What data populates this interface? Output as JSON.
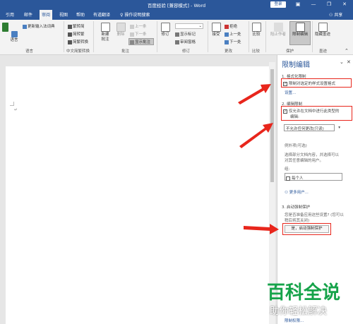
{
  "titlebar": {
    "title": "百度经验 [兼容模式] - Word",
    "login_label": "登录",
    "minimize_icon": "minimize-icon",
    "restore_icon": "restore-icon",
    "close_icon": "close-icon"
  },
  "tabs": [
    "引用",
    "邮件",
    "审阅",
    "视图",
    "帮助",
    "有道翻译"
  ],
  "active_tab": "审阅",
  "tell_me": "操作说明搜索",
  "share_label": "共享",
  "ribbon": {
    "language_group": {
      "item1": "更新输入法词典",
      "item2": "语言",
      "label": "语言"
    },
    "chinese_group": {
      "trad_to_simp": "繁转简",
      "simp_to_trad": "简转繁",
      "convert": "简繁转换",
      "label": "中文简繁转换"
    },
    "comments_group": {
      "new_comment": "新建批注",
      "new_comment_l1": "新建",
      "new_comment_l2": "批注",
      "delete": "删除",
      "previous": "上一条",
      "next": "下一条",
      "show_comments": "显示批注",
      "label": "批注"
    },
    "tracking_group": {
      "track_changes": "修订",
      "show_markup": "显示标记",
      "reviewing_pane": "审阅窗格",
      "label": "修订"
    },
    "changes_group": {
      "accept": "接受",
      "reject": "拒绝",
      "previous": "上一处",
      "next": "下一处",
      "label": "更改"
    },
    "compare_group": {
      "compare": "比较",
      "label": "比较"
    },
    "protect_group": {
      "block_authors": "阻止作者",
      "restrict_editing": "限制编辑",
      "label": "保护"
    },
    "ink_group": {
      "hide_ink": "隐藏墨迹",
      "label": "墨迹"
    }
  },
  "pane": {
    "title": "限制编辑",
    "section1": "1. 格式化限制",
    "formatting_checkbox": "限制对选定的样式设置格式",
    "formatting_checked": true,
    "settings_link": "设置...",
    "section2": "2. 编辑限制",
    "editing_checkbox_line1": "仅允许在文档中进行此类型的",
    "editing_checkbox_line2": "编辑:",
    "editing_checked": true,
    "editing_dropdown": "不允许任何更改(只读)",
    "exceptions_title": "例外项(可选)",
    "exceptions_desc1": "选择部分文档内容，并选择可以",
    "exceptions_desc2": "对其任意编辑的用户。",
    "groups_label": "组:",
    "everyone": "每个人",
    "more_users": "更多用户...",
    "section3": "3. 启动强制保护",
    "start_desc1": "您是否准备应用这些设置? (您可以",
    "start_desc2": "稍后将其关闭)",
    "start_button": "是，启动强制保护",
    "bottom_link": "限制权限..."
  },
  "watermark": {
    "line1": "百科全说",
    "line2": "助你轻松解决"
  },
  "colors": {
    "word_blue": "#2b579a",
    "arrow_red": "#e8261c",
    "watermark_green": "#16a34a"
  }
}
